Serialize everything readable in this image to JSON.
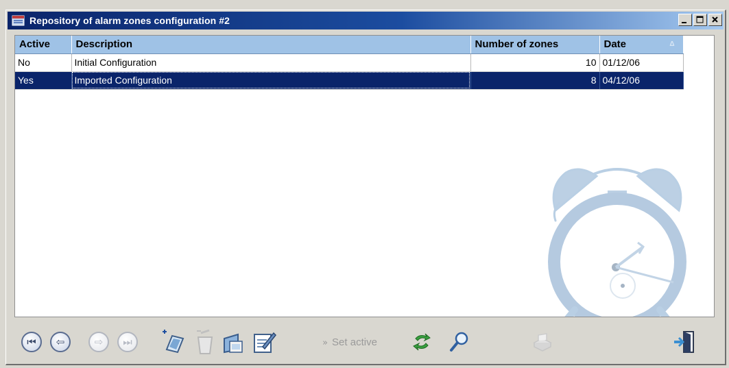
{
  "window": {
    "title": "Repository of alarm zones configuration #2",
    "buttons": {
      "minimize": "_",
      "maximize": "□",
      "close": "x"
    }
  },
  "grid": {
    "columns": [
      "Active",
      "Description",
      "Number of zones",
      "Date"
    ],
    "sort_indicator": "Δ",
    "rows": [
      {
        "active": "No",
        "description": "Initial Configuration",
        "zones": "10",
        "date": "01/12/06",
        "selected": false
      },
      {
        "active": "Yes",
        "description": "Imported Configuration",
        "zones": "8",
        "date": "04/12/06",
        "selected": true
      }
    ],
    "background_icon": "alarm-clock-icon"
  },
  "toolbar": {
    "first": {
      "icon": "first-record-icon",
      "enabled": true
    },
    "prev": {
      "icon": "previous-record-icon",
      "enabled": true
    },
    "next": {
      "icon": "next-record-icon",
      "enabled": false
    },
    "last": {
      "icon": "last-record-icon",
      "enabled": false
    },
    "add": {
      "icon": "add-record-icon",
      "enabled": true
    },
    "delete": {
      "icon": "delete-record-icon",
      "enabled": false
    },
    "open": {
      "icon": "open-record-icon",
      "enabled": true
    },
    "edit": {
      "icon": "edit-record-icon",
      "enabled": true
    },
    "set_active_label": "Set active",
    "set_active_enabled": false,
    "refresh": {
      "icon": "refresh-icon",
      "enabled": true
    },
    "search": {
      "icon": "search-icon",
      "enabled": true
    },
    "print": {
      "icon": "print-icon",
      "enabled": false
    },
    "exit": {
      "icon": "exit-door-icon",
      "enabled": true
    }
  },
  "colors": {
    "title_bar": "#0a246a",
    "header_bg": "#9fc2e6",
    "selection": "#0a246a",
    "window_bg": "#d9d7d0"
  }
}
